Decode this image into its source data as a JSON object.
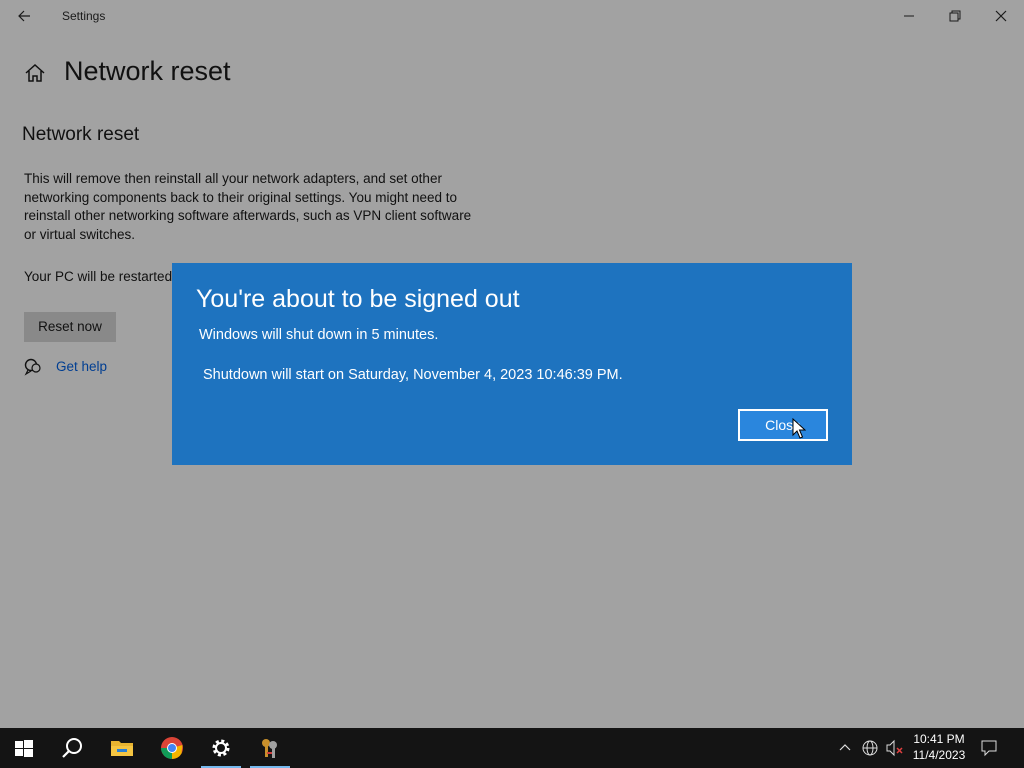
{
  "window": {
    "title": "Settings",
    "back_icon": "back-arrow-icon",
    "minimize_icon": "minimize-icon",
    "restore_icon": "restore-icon",
    "close_icon": "close-icon"
  },
  "page": {
    "title": "Network reset",
    "home_icon": "home-icon",
    "section_title": "Network reset",
    "description": "This will remove then reinstall all your network adapters, and set other networking components back to their original settings. You might need to reinstall other networking software afterwards, such as VPN client software or virtual switches.",
    "restart_note": "Your PC will be restarted.",
    "reset_button": "Reset now",
    "help_link": "Get help",
    "help_icon": "help-chat-icon"
  },
  "dialog": {
    "title": "You're about to be signed out",
    "message1": "Windows will shut down in 5 minutes.",
    "message2": "Shutdown will start on Saturday, November 4, 2023 10:46:39 PM.",
    "close_button": "Close",
    "background_color": "#1e73bf"
  },
  "taskbar": {
    "items": [
      {
        "name": "start",
        "icon": "windows-logo-icon"
      },
      {
        "name": "search",
        "icon": "search-icon"
      },
      {
        "name": "file-explorer",
        "icon": "folder-icon"
      },
      {
        "name": "chrome",
        "icon": "chrome-icon"
      },
      {
        "name": "settings",
        "icon": "gear-icon",
        "active": true
      },
      {
        "name": "app",
        "icon": "keys-app-icon",
        "active": true
      }
    ],
    "tray": {
      "chevron_icon": "chevron-up-icon",
      "network_icon": "globe-network-icon",
      "volume_icon": "volume-muted-icon",
      "time": "10:41 PM",
      "date": "11/4/2023",
      "notifications_icon": "notification-icon"
    }
  }
}
